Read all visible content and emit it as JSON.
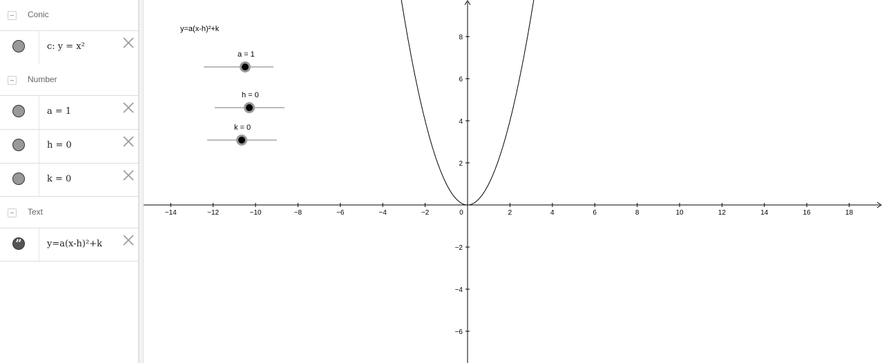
{
  "algebra": {
    "groups": [
      {
        "label": "Conic",
        "items": [
          {
            "text": "c: y = x²",
            "marble": "filled"
          }
        ]
      },
      {
        "label": "Number",
        "items": [
          {
            "text": "a = 1",
            "marble": "filled"
          },
          {
            "text": "h = 0",
            "marble": "filled"
          },
          {
            "text": "k = 0",
            "marble": "filled"
          }
        ]
      },
      {
        "label": "Text",
        "items": [
          {
            "text": "y=a(x-h)²+k",
            "marble": "quote"
          }
        ]
      }
    ]
  },
  "graphics": {
    "formula_text": "y=a(x-h)²+k",
    "sliders": [
      {
        "label": "a = 1",
        "value": 1,
        "min": -5,
        "max": 5
      },
      {
        "label": "h = 0",
        "value": 0,
        "min": -5,
        "max": 5
      },
      {
        "label": "k = 0",
        "value": 0,
        "min": -5,
        "max": 5
      }
    ],
    "x_ticks": [
      "−14",
      "−12",
      "−10",
      "−8",
      "−6",
      "−4",
      "−2",
      "0",
      "2",
      "4",
      "6",
      "8",
      "10",
      "12",
      "14",
      "16",
      "18"
    ],
    "y_ticks": [
      "8",
      "6",
      "4",
      "2",
      "−2",
      "−4",
      "−6"
    ],
    "curve": {
      "name": "c",
      "a": 1,
      "h": 0,
      "k": 0,
      "color": "#000000"
    }
  }
}
